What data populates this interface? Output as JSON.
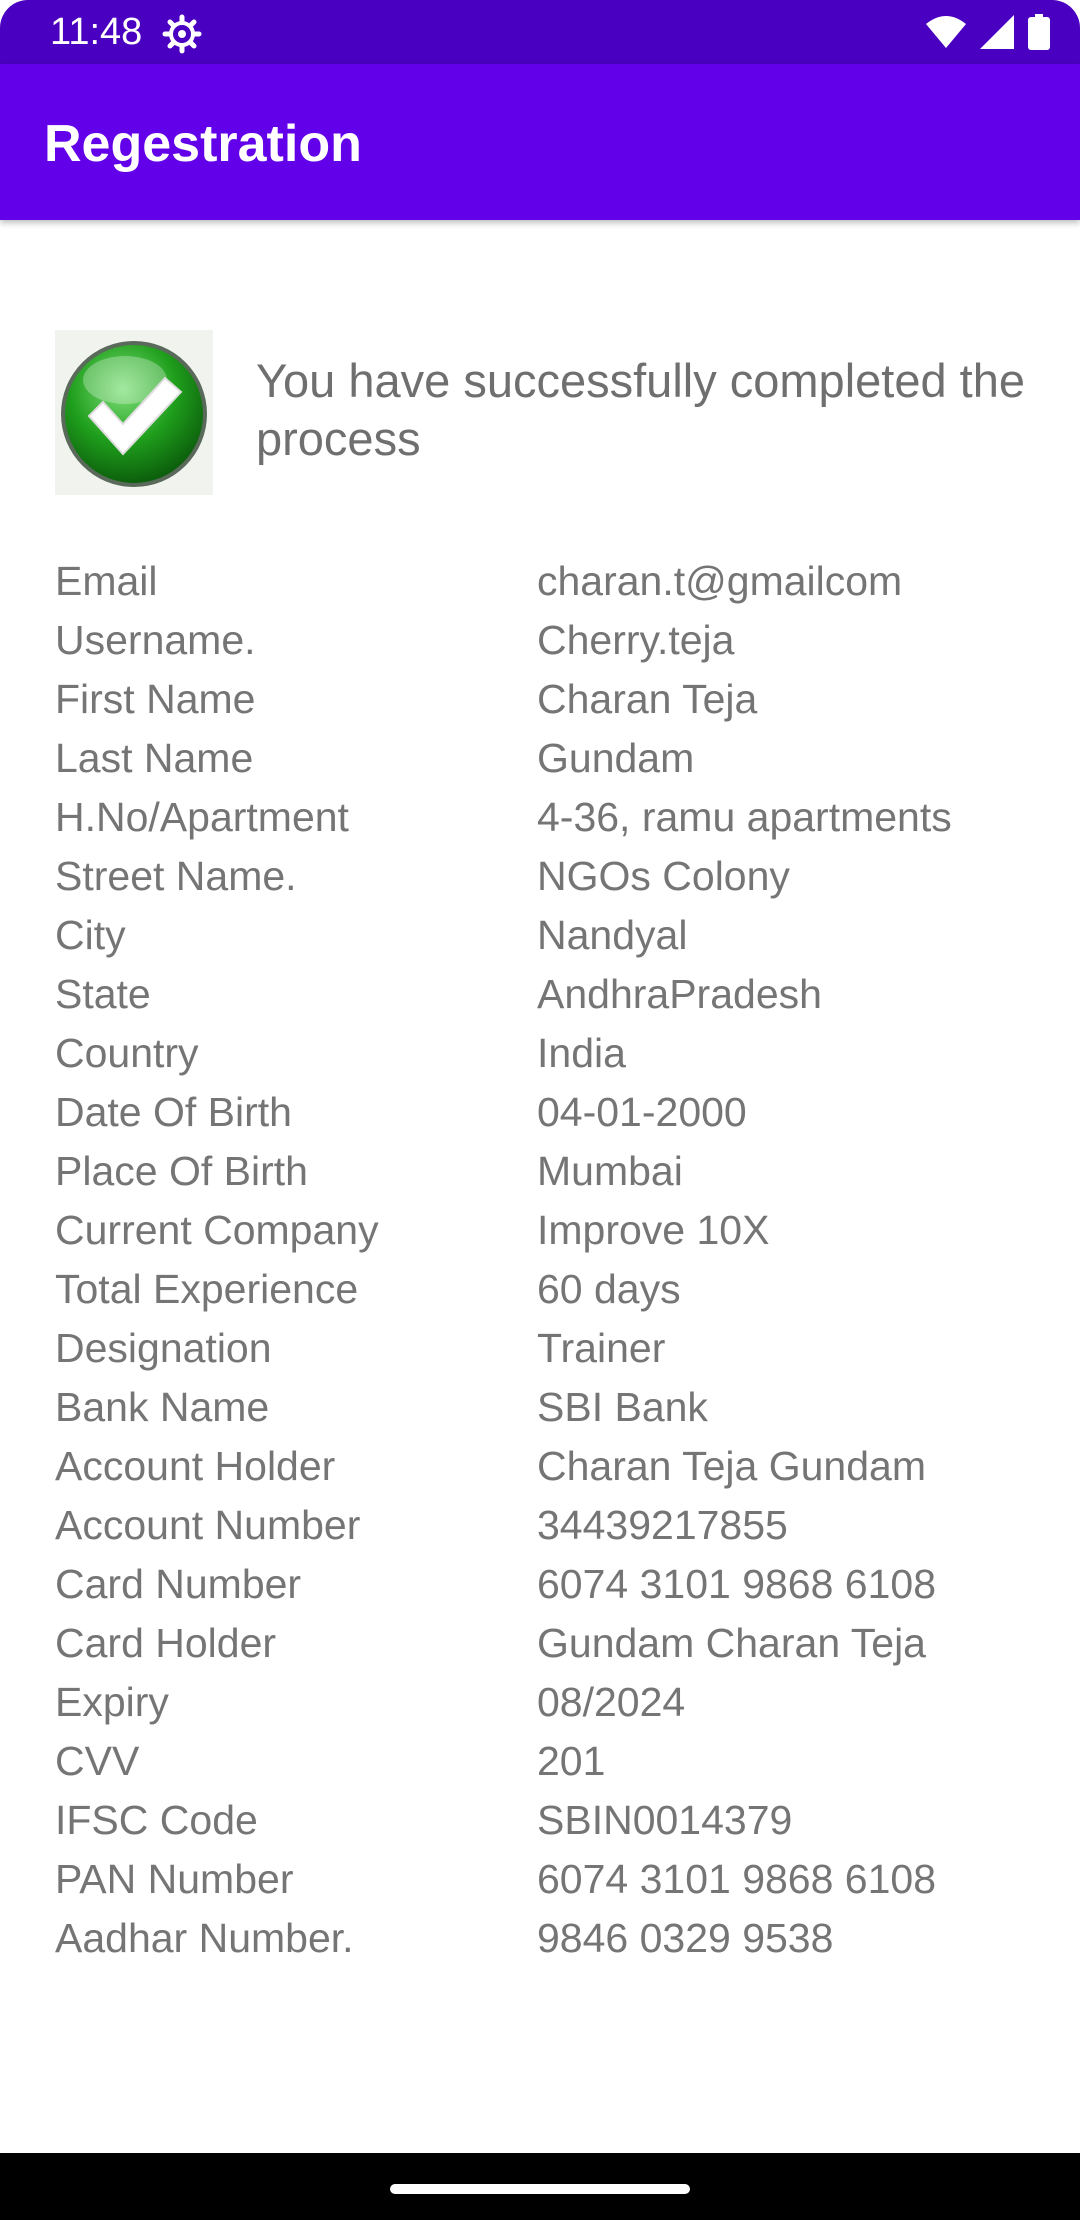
{
  "status_bar": {
    "time": "11:48",
    "icons": [
      "settings-gear-icon",
      "wifi-icon",
      "signal-icon",
      "battery-icon"
    ],
    "background": "#4a00c0"
  },
  "app_bar": {
    "title": "Regestration",
    "background": "#6200ea"
  },
  "success": {
    "icon": "check-circle-icon",
    "message": "You have successfully completed the process"
  },
  "details": [
    {
      "label": "Email",
      "value": "charan.t@gmailcom"
    },
    {
      "label": "Username.",
      "value": "Cherry.teja"
    },
    {
      "label": "First Name",
      "value": "Charan Teja"
    },
    {
      "label": "Last Name",
      "value": "Gundam"
    },
    {
      "label": "H.No/Apartment",
      "value": "4-36, ramu apartments"
    },
    {
      "label": "Street Name.",
      "value": "NGOs Colony"
    },
    {
      "label": "City",
      "value": "Nandyal"
    },
    {
      "label": "State",
      "value": "AndhraPradesh"
    },
    {
      "label": "Country",
      "value": "India"
    },
    {
      "label": "Date Of Birth",
      "value": "04-01-2000"
    },
    {
      "label": "Place Of Birth",
      "value": "Mumbai"
    },
    {
      "label": "Current Company",
      "value": "Improve 10X"
    },
    {
      "label": "Total Experience",
      "value": "60 days"
    },
    {
      "label": "Designation",
      "value": "Trainer"
    },
    {
      "label": "Bank Name",
      "value": "SBI Bank"
    },
    {
      "label": "Account Holder",
      "value": "Charan Teja Gundam"
    },
    {
      "label": "Account Number",
      "value": "34439217855"
    },
    {
      "label": "Card Number",
      "value": "6074 3101 9868 6108"
    },
    {
      "label": "Card Holder",
      "value": "Gundam Charan Teja"
    },
    {
      "label": "Expiry",
      "value": "08/2024"
    },
    {
      "label": "CVV",
      "value": "201"
    },
    {
      "label": "IFSC Code",
      "value": "SBIN0014379"
    },
    {
      "label": "PAN Number",
      "value": "6074 3101 9868 6108"
    },
    {
      "label": "Aadhar Number.",
      "value": "9846 0329 9538"
    }
  ]
}
